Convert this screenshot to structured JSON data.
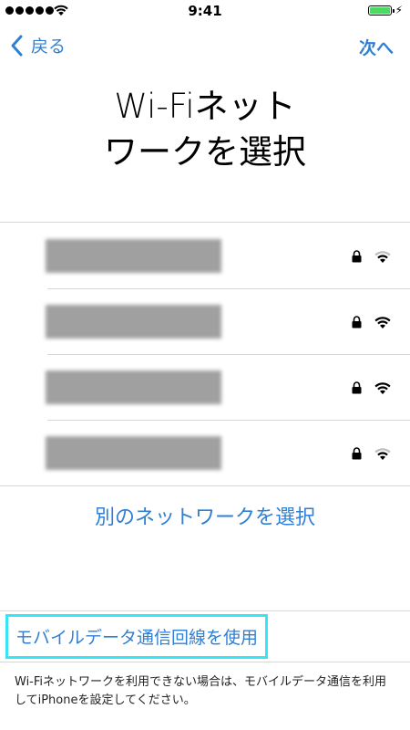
{
  "status_bar": {
    "time": "9:41",
    "signal_bars": 5,
    "battery_level": 1.0,
    "battery_color": "#4cd964"
  },
  "nav": {
    "back_label": "戻る",
    "next_label": "次へ"
  },
  "title": {
    "line1": "Wi-Fiネット",
    "line2": "ワークを選択"
  },
  "networks": [
    {
      "name_redacted": true,
      "locked": true,
      "signal_strength": 0.66
    },
    {
      "name_redacted": true,
      "locked": true,
      "signal_strength": 1.0
    },
    {
      "name_redacted": true,
      "locked": true,
      "signal_strength": 1.0
    },
    {
      "name_redacted": true,
      "locked": true,
      "signal_strength": 0.66
    }
  ],
  "other_network_label": "別のネットワークを選択",
  "cellular_label": "モバイルデータ通信回線を使用",
  "footnote": "Wi-Fiネットワークを利用できない場合は、モバイルデータ通信を利用してiPhoneを設定してください。",
  "colors": {
    "accent": "#2f7fd4",
    "highlight": "#37e6f6"
  }
}
